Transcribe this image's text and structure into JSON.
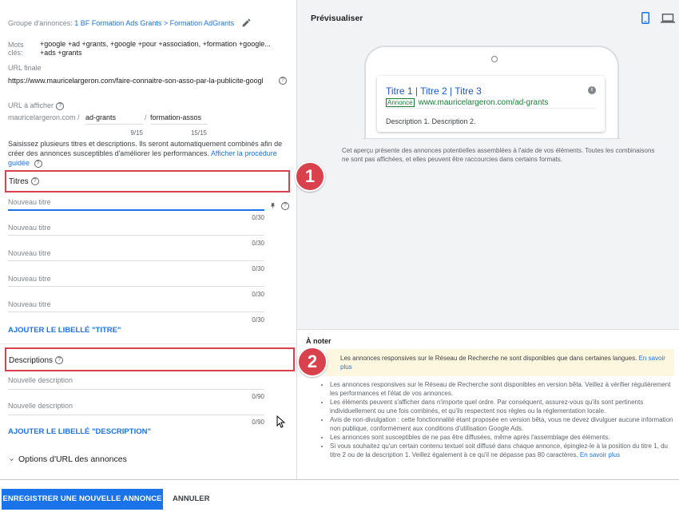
{
  "form": {
    "ad_group_label": "Groupe d'annonces:",
    "ad_group_link": "1 BF Formation Ads Grants > Formation AdGrants",
    "keywords_label_1": "Mots",
    "keywords_label_2": "clés:",
    "keywords_line1": "+google +ad +grants, +google +pour +association, +formation +google...",
    "keywords_line2": "+ads +grants",
    "final_url_label": "URL finale",
    "final_url_value": "https://www.mauricelargeron.com/faire-connaitre-son-asso-par-la-publicite-googl",
    "display_url_label": "URL à afficher",
    "display_url_domain": "mauricelargeron.com /",
    "display_url_path1": "ad-grants",
    "display_url_sep": "/",
    "display_url_path2": "formation-assos",
    "path1_counter": "9/15",
    "path2_counter": "15/15",
    "instructions": "Saisissez plusieurs titres et descriptions. Ils seront automatiquement combinés afin de créer des annonces susceptibles d'améliorer les performances.",
    "instructions_link": "Afficher la procédure guidée",
    "titles_heading": "Titres",
    "titles": [
      {
        "placeholder": "Nouveau titre",
        "counter": "0/30"
      },
      {
        "placeholder": "Nouveau titre",
        "counter": "0/30"
      },
      {
        "placeholder": "Nouveau titre",
        "counter": "0/30"
      },
      {
        "placeholder": "Nouveau titre",
        "counter": "0/30"
      },
      {
        "placeholder": "Nouveau titre",
        "counter": "0/30"
      }
    ],
    "add_title_label": "AJOUTER LE LIBELLÉ \"TITRE\"",
    "descriptions_heading": "Descriptions",
    "descriptions": [
      {
        "placeholder": "Nouvelle description",
        "counter": "0/90"
      },
      {
        "placeholder": "Nouvelle description",
        "counter": "0/90"
      }
    ],
    "add_description_label": "AJOUTER LE LIBELLÉ \"DESCRIPTION\"",
    "url_options_label": "Options d'URL des annonces"
  },
  "annotations": {
    "badge1": "1",
    "badge2": "2"
  },
  "preview": {
    "heading": "Prévisualiser",
    "ad_title": "Titre 1 | Titre 2 | Titre 3",
    "ad_badge": "Annonce",
    "ad_url": "www.mauricelargeron.com/ad-grants",
    "ad_description": "Description 1. Description 2.",
    "caption": "Cet aperçu présente des annonces potentielles assemblées à l'aide de vos éléments. Toutes les combinaisons ne sont pas affichées, et elles peuvent être raccourcies dans certains formats."
  },
  "notes": {
    "heading": "À noter",
    "warning": "Les annonces responsives sur le Réseau de Recherche ne sont disponibles que dans certaines langues.",
    "warning_link": "En savoir plus",
    "items": [
      "Les annonces responsives sur le Réseau de Recherche sont disponibles en version bêta. Veillez à vérifier régulièrement les performances et l'état de vos annonces.",
      "Les éléments peuvent s'afficher dans n'importe quel ordre. Par conséquent, assurez-vous qu'ils sont pertinents individuellement ou une fois combinés, et qu'ils respectent nos règles ou la réglementation locale.",
      "Avis de non-divulgation : cette fonctionnalité étant proposée en version bêta, vous ne devez divulguer aucune information non publique, conformément aux conditions d'utilisation Google Ads.",
      "Les annonces sont susceptibles de ne pas être diffusées, même après l'assemblage des éléments."
    ],
    "last_item": "Si vous souhaitez qu'un certain contenu textuel soit diffusé dans chaque annonce, épinglez-le à la position du titre 1, du titre 2 ou de la description 1. Veillez également à ce qu'il ne dépasse pas 80 caractères.",
    "last_link": "En savoir plus"
  },
  "footer": {
    "save_label": "ENREGISTRER UNE NOUVELLE ANNONCE",
    "cancel_label": "ANNULER"
  },
  "colors": {
    "accent": "#1a73e8",
    "annotation_red": "#d9414d",
    "ad_green": "#188038"
  }
}
